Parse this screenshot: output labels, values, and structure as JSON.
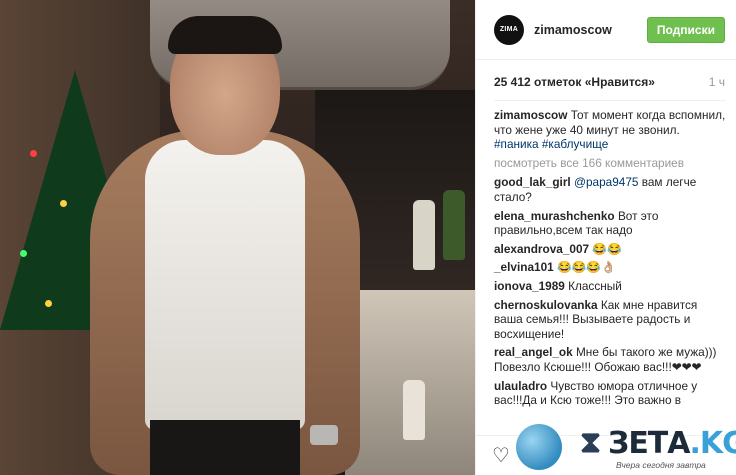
{
  "post": {
    "username": "zimamoscow",
    "avatar_text": "ZIMA",
    "follow_label": "Подписки",
    "likes": "25 412 отметок «Нравится»",
    "time_ago": "1 ч",
    "caption": {
      "user": "zimamoscow",
      "text": "Тот момент когда вспомнил, что жене уже 40 минут не звонил.",
      "hashtags": "#паника #каблучище"
    },
    "view_all_comments": "посмотреть все 166 комментариев"
  },
  "comments": [
    {
      "user": "good_lak_girl",
      "mention": "@papa9475",
      "text": "вам легче стало?"
    },
    {
      "user": "elena_murashchenko",
      "mention": "",
      "text": "Вот это правильно,всем так надо"
    },
    {
      "user": "alexandrova_007",
      "mention": "",
      "text": "😂😂"
    },
    {
      "user": "_elvina101",
      "mention": "",
      "text": "😂😂😂👌🏼"
    },
    {
      "user": "ionova_1989",
      "mention": "",
      "text": "Классный"
    },
    {
      "user": "chernoskulovanka",
      "mention": "",
      "text": "Как мне нравится ваша семья!!! Вызываете радость и восхищение!"
    },
    {
      "user": "real_angel_ok",
      "mention": "",
      "text": "Мне бы такого же мужа))) Повезло Ксюше!!! Обожаю вас!!!❤❤❤"
    },
    {
      "user": "ulauladro",
      "mention": "",
      "text": "Чувство юмора отличное у вас!!!Да и Ксю тоже!!! Это важно в"
    }
  ],
  "actions": {
    "like_icon": "heart-outline-icon"
  },
  "watermark": {
    "brand": "ЗЕТА",
    "tld": ".KG",
    "slogan": "Вчера сегодня завтра"
  }
}
